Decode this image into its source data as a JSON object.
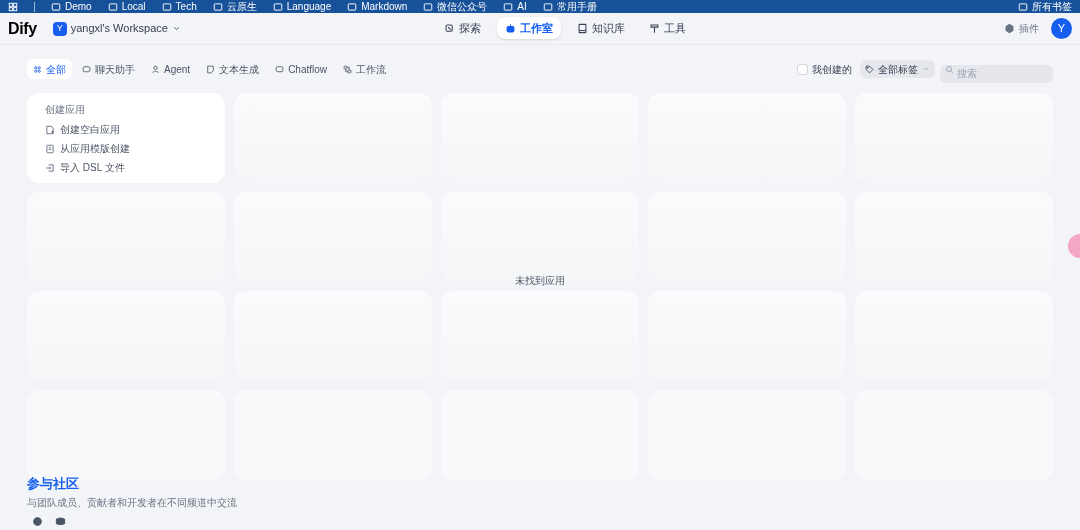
{
  "bookmarks_bar": {
    "items": [
      "Demo",
      "Local",
      "Tech",
      "云原生",
      "Language",
      "Markdown",
      "微信公众号",
      "AI",
      "常用手册"
    ],
    "all_bookmarks": "所有书签"
  },
  "header": {
    "logo": "Dify",
    "workspace": {
      "initial": "Y",
      "name": "yangxl's Workspace"
    },
    "nav": [
      {
        "label": "探索",
        "selected": false
      },
      {
        "label": "工作室",
        "selected": true
      },
      {
        "label": "知识库",
        "selected": false
      },
      {
        "label": "工具",
        "selected": false
      }
    ],
    "plugins": "插件",
    "avatar": "Y"
  },
  "filters": {
    "tabs": [
      {
        "label": "全部",
        "selected": true
      },
      {
        "label": "聊天助手",
        "selected": false
      },
      {
        "label": "Agent",
        "selected": false
      },
      {
        "label": "文本生成",
        "selected": false
      },
      {
        "label": "Chatflow",
        "selected": false
      },
      {
        "label": "工作流",
        "selected": false
      }
    ],
    "my_created": {
      "label": "我创建的",
      "checked": false
    },
    "tag_filter": "全部标签",
    "search": {
      "placeholder": "搜索"
    }
  },
  "create_card": {
    "title": "创建应用",
    "actions": [
      "创建空白应用",
      "从应用模版创建",
      "导入 DSL 文件"
    ]
  },
  "empty_message": "未找到应用",
  "community": {
    "title": "参与社区",
    "subtitle": "与团队成员、贡献者和开发者在不同频道中交流"
  }
}
